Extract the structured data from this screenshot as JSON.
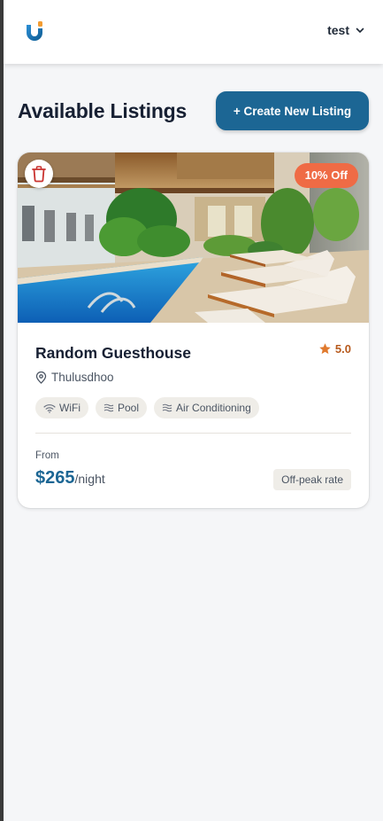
{
  "header": {
    "logo_icon": "brand-logo-icon",
    "username": "test",
    "dropdown_icon": "chevron-down-icon"
  },
  "main": {
    "title": "Available Listings",
    "create_button_label": "+ Create New Listing"
  },
  "listing": {
    "image_alt": "Hotel courtyard with swimming pool, palm trees and sun loungers",
    "delete_icon": "trash-icon",
    "discount_badge": "10% Off",
    "name": "Random Guesthouse",
    "rating": "5.0",
    "location": "Thulusdhoo",
    "amenities": [
      {
        "icon": "wifi-icon",
        "label": "WiFi"
      },
      {
        "icon": "waves-icon",
        "label": "Pool"
      },
      {
        "icon": "waves-icon",
        "label": "Air Conditioning"
      }
    ],
    "from_label": "From",
    "price": "$265",
    "per_unit": "/night",
    "rate_badge": "Off-peak rate"
  },
  "colors": {
    "primary": "#1c6694",
    "discount": "#ef6b45",
    "star": "#e07a2e",
    "trash": "#c9322f",
    "chip_bg": "#efede8",
    "page_bg": "#f5f6f8"
  }
}
